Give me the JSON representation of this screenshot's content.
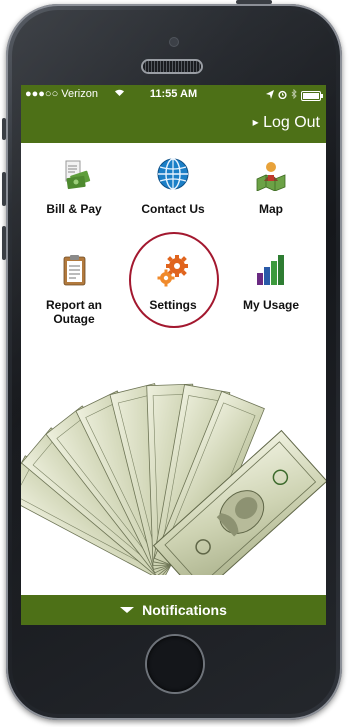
{
  "status_bar": {
    "carrier": "●●●○○ Verizon",
    "time": "11:55 AM"
  },
  "header": {
    "logout_label": "Log Out"
  },
  "tiles": [
    {
      "label": "Bill & Pay",
      "icon": "bill-pay-icon"
    },
    {
      "label": "Contact Us",
      "icon": "globe-icon"
    },
    {
      "label": "Map",
      "icon": "map-icon"
    },
    {
      "label": "Report an Outage",
      "icon": "clipboard-icon"
    },
    {
      "label": "Settings",
      "icon": "gears-icon"
    },
    {
      "label": "My Usage",
      "icon": "bar-chart-icon"
    }
  ],
  "footer": {
    "notifications_label": "Notifications"
  },
  "colors": {
    "brand_green": "#4d7017",
    "highlight_circle": "#a3182f"
  }
}
